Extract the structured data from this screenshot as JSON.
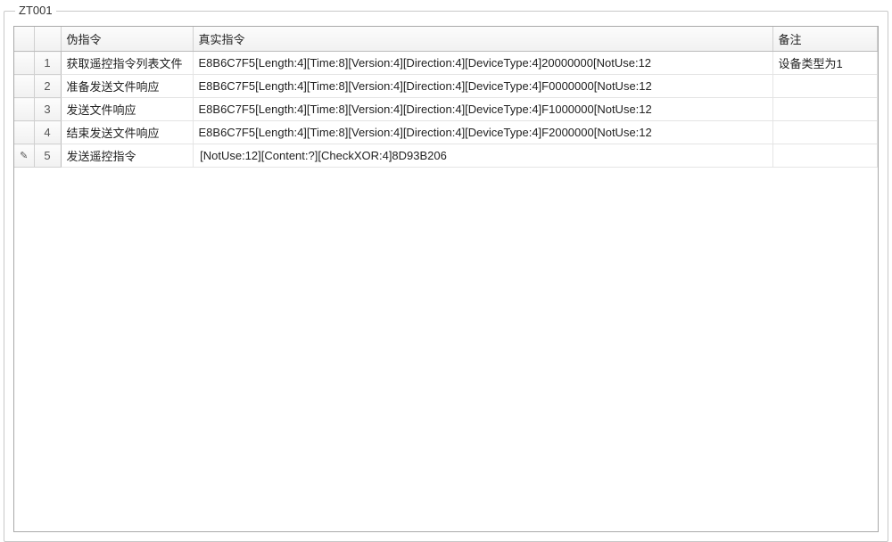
{
  "group": {
    "title": "ZT001"
  },
  "columns": {
    "marker": "",
    "num": "",
    "pseudo": "伪指令",
    "real": "真实指令",
    "remark": "备注"
  },
  "rows": [
    {
      "marker": "",
      "num": "1",
      "pseudo": "获取遥控指令列表文件",
      "real": "E8B6C7F5[Length:4][Time:8][Version:4][Direction:4][DeviceType:4]20000000[NotUse:12",
      "remark": "设备类型为1"
    },
    {
      "marker": "",
      "num": "2",
      "pseudo": "准备发送文件响应",
      "real": "E8B6C7F5[Length:4][Time:8][Version:4][Direction:4][DeviceType:4]F0000000[NotUse:12",
      "remark": ""
    },
    {
      "marker": "",
      "num": "3",
      "pseudo": "发送文件响应",
      "real": "E8B6C7F5[Length:4][Time:8][Version:4][Direction:4][DeviceType:4]F1000000[NotUse:12",
      "remark": ""
    },
    {
      "marker": "",
      "num": "4",
      "pseudo": "结束发送文件响应",
      "real": "E8B6C7F5[Length:4][Time:8][Version:4][Direction:4][DeviceType:4]F2000000[NotUse:12",
      "remark": ""
    },
    {
      "marker": "✎",
      "num": "5",
      "pseudo": "发送遥控指令",
      "real": " [NotUse:12][Content:?][CheckXOR:4]8D93B206",
      "remark": ""
    }
  ]
}
